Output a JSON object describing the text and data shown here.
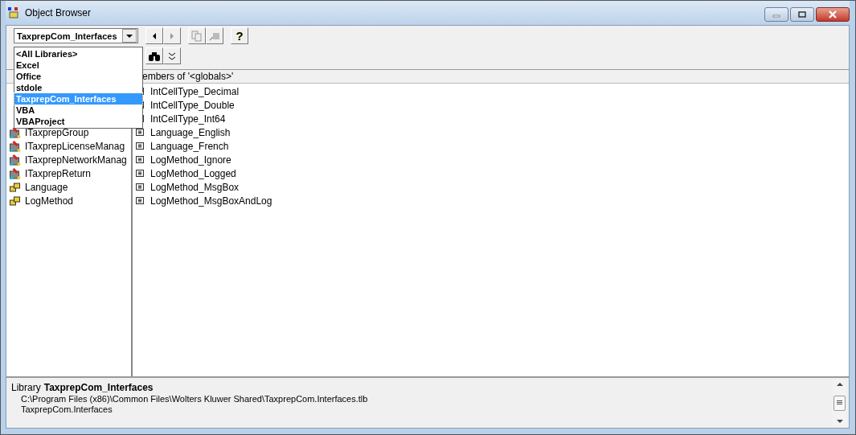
{
  "window": {
    "title": "Object Browser"
  },
  "library_combo": {
    "value": "TaxprepCom_Interfaces"
  },
  "library_dropdown": [
    {
      "label": "<All Libraries>",
      "selected": false
    },
    {
      "label": "Excel",
      "selected": false
    },
    {
      "label": "Office",
      "selected": false
    },
    {
      "label": "stdole",
      "selected": false
    },
    {
      "label": "TaxprepCom_Interfaces",
      "selected": true
    },
    {
      "label": "VBA",
      "selected": false
    },
    {
      "label": "VBAProject",
      "selected": false
    }
  ],
  "toolbar": {
    "help": "?"
  },
  "members_header": "embers of '<globals>'",
  "classes": [
    {
      "label": "ITaxprepGroup",
      "kind": "interface"
    },
    {
      "label": "ITaxprepLicenseManag",
      "kind": "interface"
    },
    {
      "label": "ITaxprepNetworkManag",
      "kind": "interface"
    },
    {
      "label": "ITaxprepReturn",
      "kind": "interface"
    },
    {
      "label": "Language",
      "kind": "enum"
    },
    {
      "label": "LogMethod",
      "kind": "enum"
    }
  ],
  "members": [
    "IntCellType_Decimal",
    "IntCellType_Double",
    "IntCellType_Int64",
    "Language_English",
    "Language_French",
    "LogMethod_Ignore",
    "LogMethod_Logged",
    "LogMethod_MsgBox",
    "LogMethod_MsgBoxAndLog"
  ],
  "details": {
    "prefix": "Library",
    "name": "TaxprepCom_Interfaces",
    "path": "C:\\Program Files (x86)\\Common Files\\Wolters Kluwer Shared\\TaxprepCom.Interfaces.tlb",
    "description": "TaxprepCom.Interfaces"
  }
}
